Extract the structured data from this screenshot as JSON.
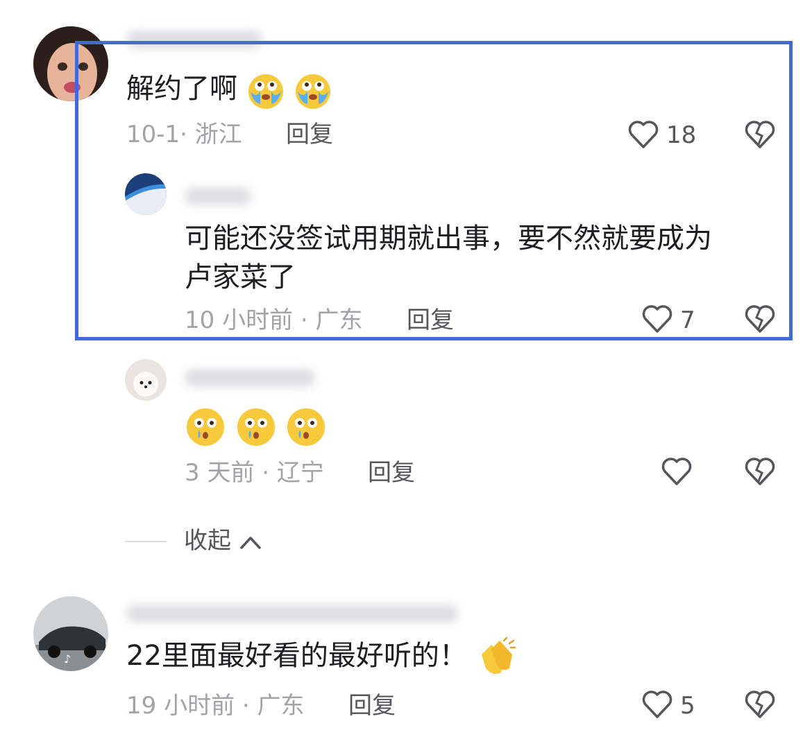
{
  "comments": [
    {
      "text": "解约了啊",
      "emojis": [
        "crying-face",
        "crying-face"
      ],
      "date": "10-1",
      "location": "浙江",
      "reply_label": "回复",
      "like_count": "18"
    },
    {
      "text_line1": "可能还没签试用期就出事，要不然就要成为",
      "text_line2": "卢家菜了",
      "date": "10 小时前",
      "location": "广东",
      "reply_label": "回复",
      "like_count": "7"
    },
    {
      "emojis": [
        "teary-face",
        "teary-face",
        "teary-face"
      ],
      "date": "3 天前",
      "location": "辽宁",
      "reply_label": "回复",
      "like_count": ""
    },
    {
      "text": "22里面最好看的最好听的！",
      "emojis": [
        "clapping-hands"
      ],
      "date": "19 小时前",
      "location": "广东",
      "reply_label": "回复",
      "like_count": "5"
    }
  ],
  "collapse_label": "收起",
  "meta_separator": "·",
  "colors": {
    "highlight": "#4169d7",
    "muted": "#a2a2a8",
    "text": "#1d1d22"
  }
}
